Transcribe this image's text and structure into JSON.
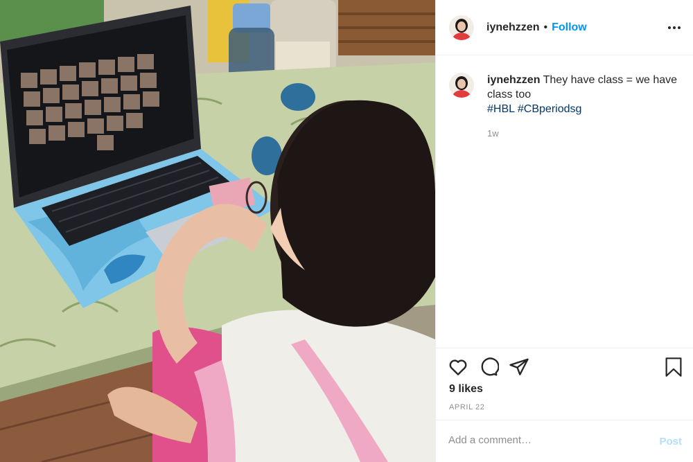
{
  "post": {
    "username": "iynehzzen",
    "separator": "•",
    "follow_label": "Follow",
    "more_icon": "more-horizontal-icon"
  },
  "caption": {
    "username": "iynehzzen",
    "text": "They have class = we have class too",
    "hashtags": [
      "#HBL",
      "#CBperiodsg"
    ],
    "age": "1w"
  },
  "actions": {
    "icons": [
      "heart-icon",
      "comment-icon",
      "share-icon",
      "bookmark-icon"
    ],
    "likes": "9 likes",
    "date": "APRIL 22"
  },
  "comment_box": {
    "placeholder": "Add a comment…",
    "post_label": "Post"
  },
  "colors": {
    "follow": "#0095f6",
    "hashtag": "#00376b",
    "post_disabled": "#b2dffc",
    "muted": "#8e8e8e"
  }
}
